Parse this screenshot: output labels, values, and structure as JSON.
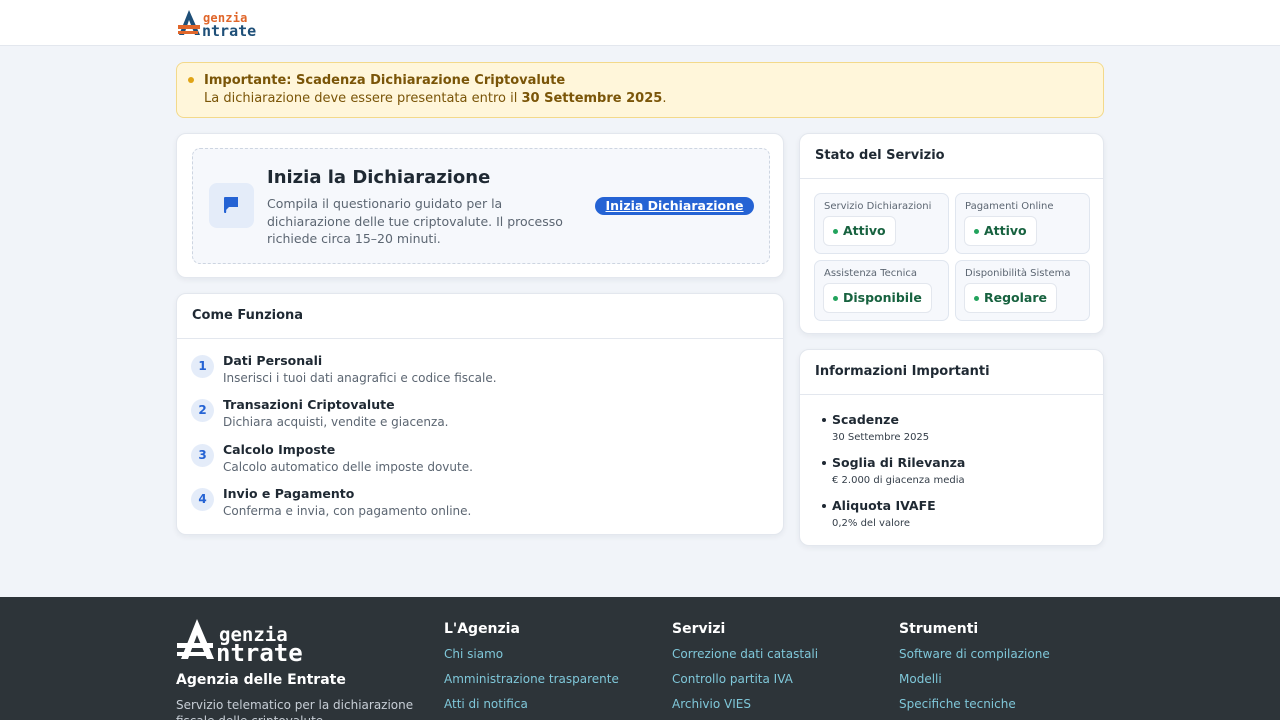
{
  "header": {
    "logo": {
      "line1": "genzia",
      "line2": "ntrate"
    }
  },
  "alert": {
    "title": "Importante: Scadenza Dichiarazione Criptovalute",
    "text_before": "La dichiarazione deve essere presentata entro il ",
    "deadline": "30 Settembre 2025",
    "text_after": "."
  },
  "start": {
    "title": "Inizia la Dichiarazione",
    "description": "Compila il questionario guidato per la dichiarazione delle tue criptovalute. Il processo richiede circa 15–20 minuti.",
    "button_label": "Inizia Dichiarazione",
    "icon": "flag-icon"
  },
  "how": {
    "title": "Come Funziona",
    "steps": [
      {
        "num": "1",
        "title": "Dati Personali",
        "desc": "Inserisci i tuoi dati anagrafici e codice fiscale."
      },
      {
        "num": "2",
        "title": "Transazioni Criptovalute",
        "desc": "Dichiara acquisti, vendite e giacenza."
      },
      {
        "num": "3",
        "title": "Calcolo Imposte",
        "desc": "Calcolo automatico delle imposte dovute."
      },
      {
        "num": "4",
        "title": "Invio e Pagamento",
        "desc": "Conferma e invia, con pagamento online."
      }
    ]
  },
  "status": {
    "title": "Stato del Servizio",
    "items": [
      {
        "label": "Servizio Dichiarazioni",
        "value": "Attivo"
      },
      {
        "label": "Pagamenti Online",
        "value": "Attivo"
      },
      {
        "label": "Assistenza Tecnica",
        "value": "Disponibile"
      },
      {
        "label": "Disponibilità Sistema",
        "value": "Regolare"
      }
    ],
    "ok_color": "#22a35c"
  },
  "info": {
    "title": "Informazioni Importanti",
    "items": [
      {
        "title": "Scadenze",
        "text": "30 Settembre 2025"
      },
      {
        "title": "Soglia di Rilevanza",
        "text": "€ 2.000 di giacenza media"
      },
      {
        "title": "Aliquota IVAFE",
        "text": "0,2% del valore"
      }
    ]
  },
  "footer": {
    "logo": {
      "line1": "genzia",
      "line2": "ntrate"
    },
    "name": "Agenzia delle Entrate",
    "description": "Servizio telematico per la dichiarazione fiscale delle criptovalute",
    "columns": [
      {
        "title": "L'Agenzia",
        "links": [
          "Chi siamo",
          "Amministrazione trasparente",
          "Atti di notifica"
        ]
      },
      {
        "title": "Servizi",
        "links": [
          "Correzione dati catastali",
          "Controllo partita IVA",
          "Archivio VIES"
        ]
      },
      {
        "title": "Strumenti",
        "links": [
          "Software di compilazione",
          "Modelli",
          "Specifiche tecniche"
        ]
      }
    ]
  },
  "colors": {
    "primary": "#2563d4",
    "alert_bg": "#fff6da",
    "footer_bg": "#2d3439",
    "footer_link": "#7fc7d9"
  }
}
